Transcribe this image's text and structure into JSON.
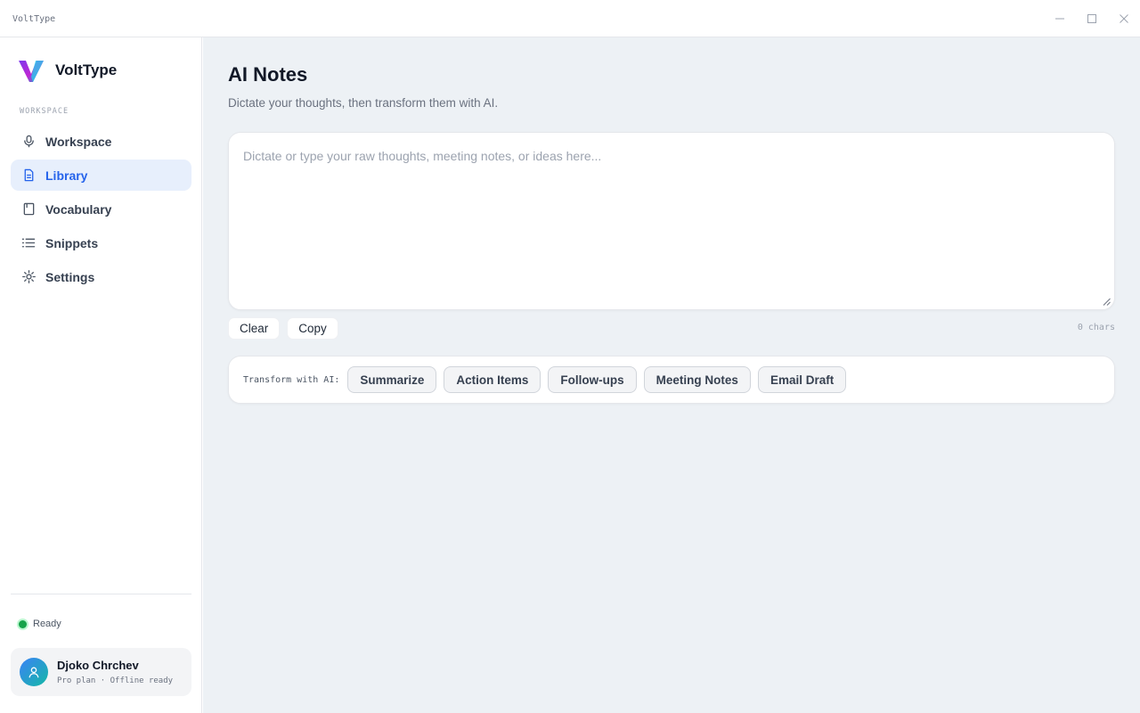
{
  "window": {
    "title": "VoltType",
    "controls": [
      "minimize-icon",
      "maximize-icon",
      "close-icon"
    ]
  },
  "sidebar": {
    "brand": "VoltType",
    "section_label": "WORKSPACE",
    "items": [
      {
        "label": "Workspace",
        "icon": "microphone-icon",
        "active": false
      },
      {
        "label": "Library",
        "icon": "document-icon",
        "active": true
      },
      {
        "label": "Vocabulary",
        "icon": "book-icon",
        "active": false
      },
      {
        "label": "Snippets",
        "icon": "list-icon",
        "active": false
      },
      {
        "label": "Settings",
        "icon": "gear-icon",
        "active": false
      }
    ],
    "status": "Ready",
    "user": {
      "name": "Djoko Chrchev",
      "plan": "Pro plan · Offline ready"
    }
  },
  "main": {
    "title": "AI Notes",
    "subtitle": "Dictate your thoughts, then transform them with AI.",
    "editor": {
      "placeholder": "Dictate or type your raw thoughts, meeting notes, or ideas here...",
      "value": ""
    },
    "actions": {
      "clear_label": "Clear",
      "copy_label": "Copy"
    },
    "char_count": "0 chars",
    "transform": {
      "label": "Transform with AI:",
      "options": [
        "Summarize",
        "Action Items",
        "Follow-ups",
        "Meeting Notes",
        "Email Draft"
      ]
    }
  },
  "colors": {
    "accent": "#2563eb",
    "active_nav_bg": "#e7effc",
    "status_ready": "#16a34a",
    "main_bg": "#edf1f5"
  }
}
